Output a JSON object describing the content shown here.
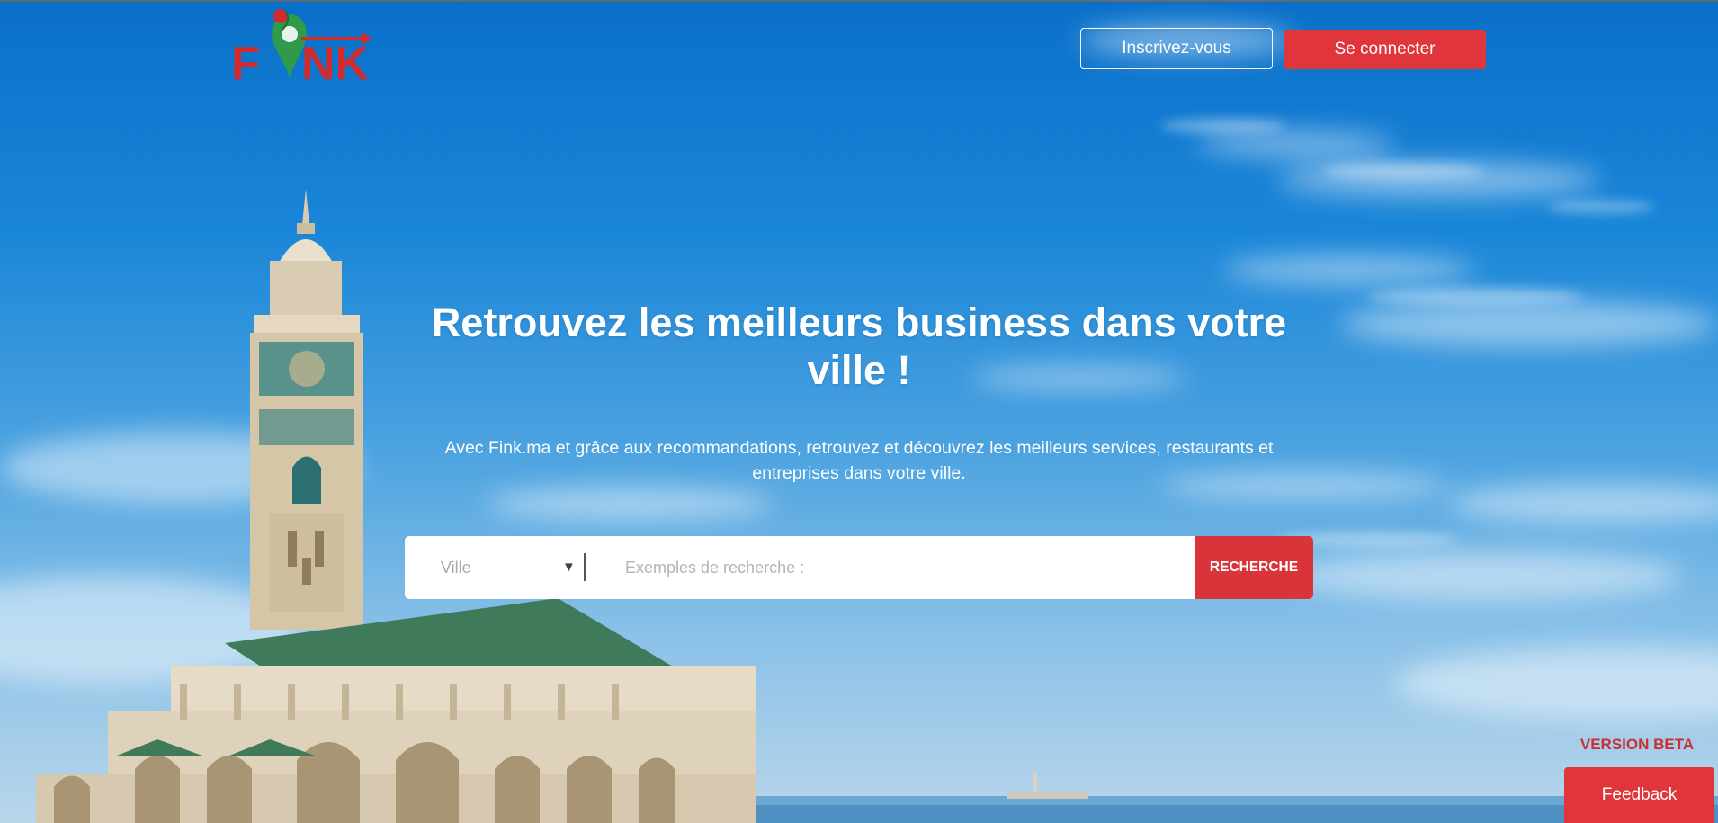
{
  "brand": {
    "logo_text": "FINK",
    "accent_color": "#e0353b",
    "logo_green": "#2f9a4a"
  },
  "header": {
    "signup_label": "Inscrivez-vous",
    "login_label": "Se connecter"
  },
  "hero": {
    "headline": "Retrouvez les meilleurs business dans votre ville !",
    "subline": "Avec Fink.ma et grâce aux recommandations, retrouvez et découvrez les meilleurs services, restaurants et entreprises dans votre ville."
  },
  "search": {
    "city_selected": "Ville",
    "city_arrow_icon": "triangle-down-icon",
    "placeholder": "Exemples de recherche :",
    "button_label": "RECHERCHE"
  },
  "footer": {
    "beta_label": "VERSION BETA",
    "feedback_label": "Feedback"
  },
  "colors": {
    "sky_top": "#0a6fc9",
    "sky_bottom": "#b9d6ea",
    "button_red": "#e0353b"
  }
}
